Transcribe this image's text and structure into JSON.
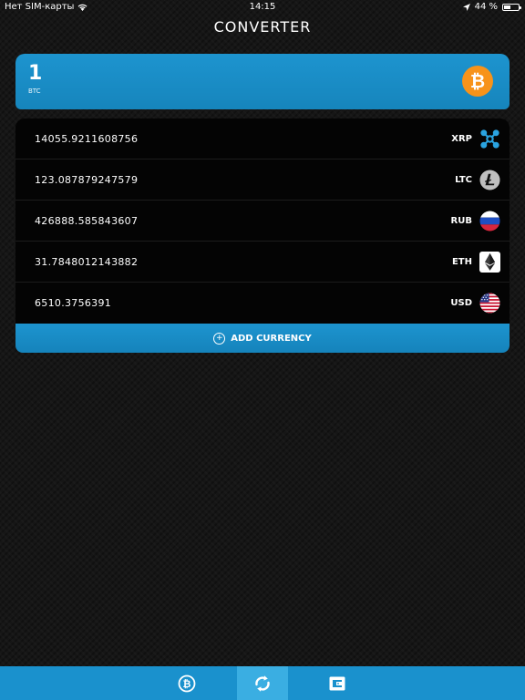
{
  "status_bar": {
    "carrier": "Нет SIM-карты",
    "time": "14:15",
    "battery_percent": "44 %",
    "battery_level": 0.44
  },
  "header": {
    "title": "CONVERTER"
  },
  "input": {
    "value": "1",
    "currency_code": "BTC",
    "icon": "bitcoin-icon",
    "accent_color": "#f7931a"
  },
  "currencies": [
    {
      "value": "14055.9211608756",
      "code": "XRP",
      "icon": "ripple-icon"
    },
    {
      "value": "123.087879247579",
      "code": "LTC",
      "icon": "litecoin-icon"
    },
    {
      "value": "426888.585843607",
      "code": "RUB",
      "icon": "russia-flag-icon"
    },
    {
      "value": "31.7848012143882",
      "code": "ETH",
      "icon": "ethereum-icon"
    },
    {
      "value": "6510.3756391",
      "code": "USD",
      "icon": "usa-flag-icon"
    }
  ],
  "add_currency": {
    "label": "ADD CURRENCY"
  },
  "tab_bar": {
    "tabs": [
      {
        "name": "bitcoin-tab",
        "icon": "bitcoin-icon",
        "active": false
      },
      {
        "name": "converter-tab",
        "icon": "refresh-icon",
        "active": true
      },
      {
        "name": "wallet-tab",
        "icon": "wallet-icon",
        "active": false
      }
    ],
    "background": "#1a91cd"
  }
}
